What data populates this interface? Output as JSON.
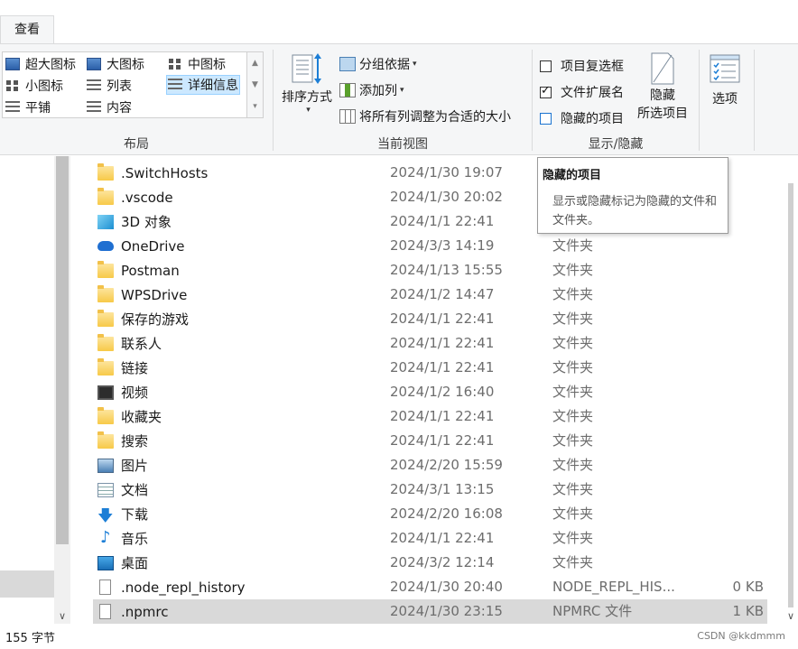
{
  "tabs": {
    "view": "查看"
  },
  "ribbon": {
    "layout": {
      "label": "布局",
      "items": [
        "超大图标",
        "大图标",
        "中图标",
        "小图标",
        "列表",
        "详细信息",
        "平铺",
        "内容"
      ],
      "selected": "详细信息"
    },
    "current_view": {
      "label": "当前视图",
      "sort": "排序方式",
      "group_by": "分组依据",
      "add_column": "添加列",
      "fit_columns": "将所有列调整为合适的大小"
    },
    "show_hide": {
      "label": "显示/隐藏",
      "item_checkboxes": "项目复选框",
      "file_extensions": "文件扩展名",
      "hidden_items": "隐藏的项目",
      "hide_selected_1": "隐藏",
      "hide_selected_2": "所选项目",
      "checked": {
        "item_checkboxes": false,
        "file_extensions": true,
        "hidden_items": false
      }
    },
    "options": "选项"
  },
  "files": [
    {
      "name": ".SwitchHosts",
      "date": "2024/1/30 19:07",
      "type": "",
      "size": "",
      "icon": "folder-icon"
    },
    {
      "name": ".vscode",
      "date": "2024/1/30 20:02",
      "type": "",
      "size": "",
      "icon": "folder-icon"
    },
    {
      "name": "3D 对象",
      "date": "2024/1/1 22:41",
      "type": "",
      "size": "",
      "icon": "3d-objects-icon"
    },
    {
      "name": "OneDrive",
      "date": "2024/3/3 14:19",
      "type": "文件夹",
      "size": "",
      "icon": "onedrive-icon"
    },
    {
      "name": "Postman",
      "date": "2024/1/13 15:55",
      "type": "文件夹",
      "size": "",
      "icon": "folder-icon"
    },
    {
      "name": "WPSDrive",
      "date": "2024/1/2 14:47",
      "type": "文件夹",
      "size": "",
      "icon": "folder-icon"
    },
    {
      "name": "保存的游戏",
      "date": "2024/1/1 22:41",
      "type": "文件夹",
      "size": "",
      "icon": "saved-games-icon"
    },
    {
      "name": "联系人",
      "date": "2024/1/1 22:41",
      "type": "文件夹",
      "size": "",
      "icon": "contacts-icon"
    },
    {
      "name": "链接",
      "date": "2024/1/1 22:41",
      "type": "文件夹",
      "size": "",
      "icon": "links-icon"
    },
    {
      "name": "视频",
      "date": "2024/1/2 16:40",
      "type": "文件夹",
      "size": "",
      "icon": "videos-icon"
    },
    {
      "name": "收藏夹",
      "date": "2024/1/1 22:41",
      "type": "文件夹",
      "size": "",
      "icon": "favorites-icon"
    },
    {
      "name": "搜索",
      "date": "2024/1/1 22:41",
      "type": "文件夹",
      "size": "",
      "icon": "searches-icon"
    },
    {
      "name": "图片",
      "date": "2024/2/20 15:59",
      "type": "文件夹",
      "size": "",
      "icon": "pictures-icon"
    },
    {
      "name": "文档",
      "date": "2024/3/1 13:15",
      "type": "文件夹",
      "size": "",
      "icon": "documents-icon"
    },
    {
      "name": "下载",
      "date": "2024/2/20 16:08",
      "type": "文件夹",
      "size": "",
      "icon": "downloads-icon"
    },
    {
      "name": "音乐",
      "date": "2024/1/1 22:41",
      "type": "文件夹",
      "size": "",
      "icon": "music-icon"
    },
    {
      "name": "桌面",
      "date": "2024/3/2 12:14",
      "type": "文件夹",
      "size": "",
      "icon": "desktop-icon"
    },
    {
      "name": ".node_repl_history",
      "date": "2024/1/30 20:40",
      "type": "NODE_REPL_HIS...",
      "size": "0 KB",
      "icon": "file-icon"
    },
    {
      "name": ".npmrc",
      "date": "2024/1/30 23:15",
      "type": "NPMRC 文件",
      "size": "1 KB",
      "icon": "file-icon"
    }
  ],
  "selected_file": ".npmrc",
  "tooltip": {
    "title": "隐藏的项目",
    "body": "显示或隐藏标记为隐藏的文件和文件夹。"
  },
  "status": {
    "count": "155 字节"
  },
  "watermark": "CSDN @kkdmmm"
}
